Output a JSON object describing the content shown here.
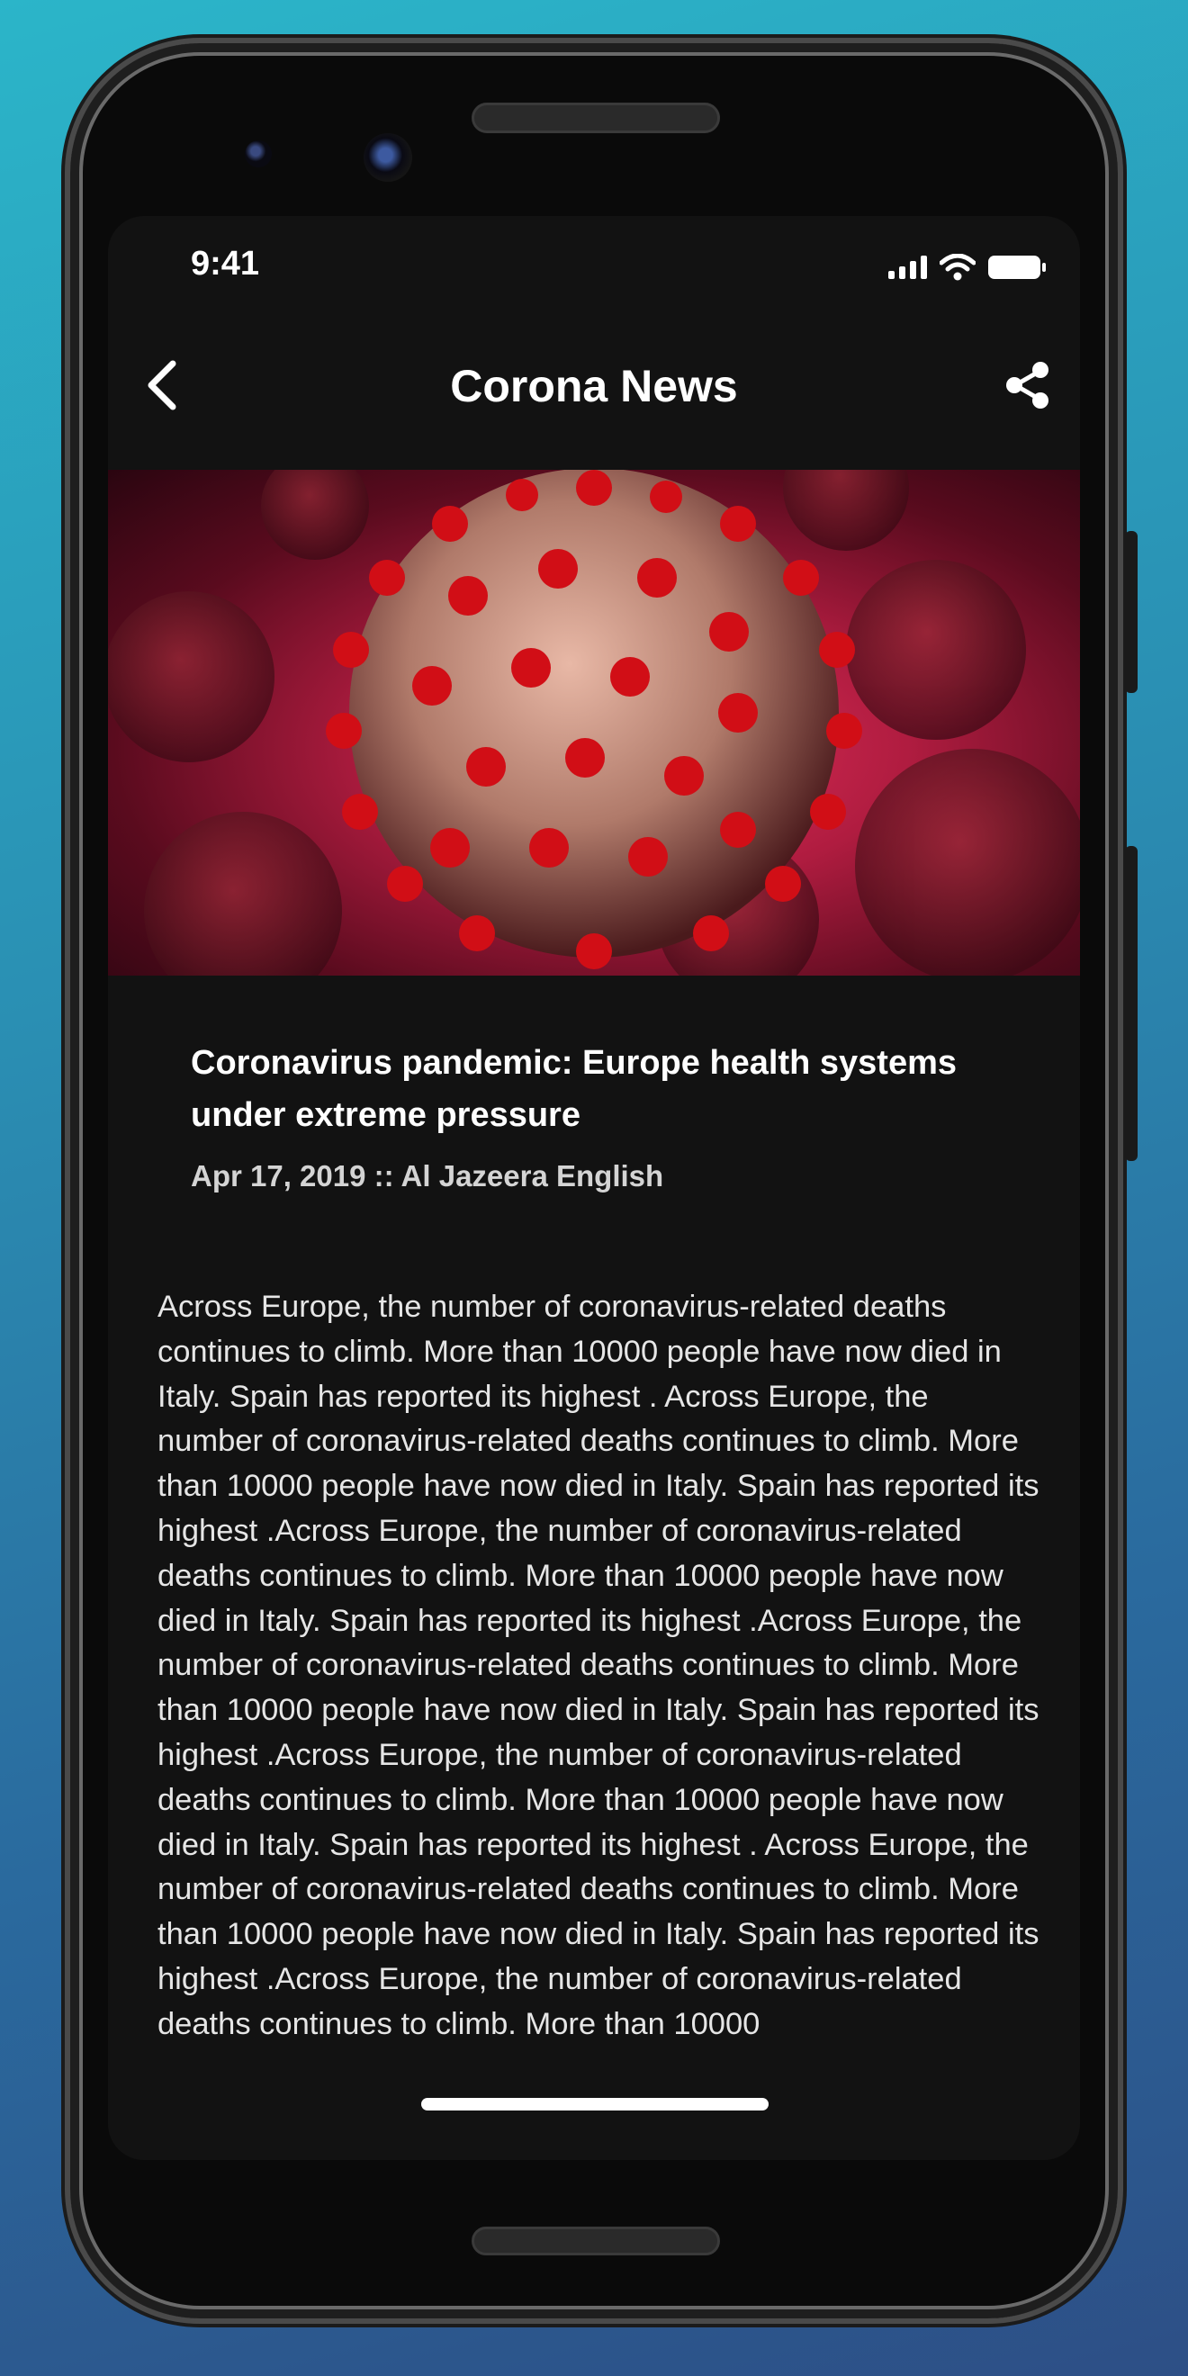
{
  "status_bar": {
    "time": "9:41"
  },
  "nav": {
    "title": "Corona News",
    "back_icon": "chevron-left-icon",
    "share_icon": "share-icon"
  },
  "hero": {
    "image": "coronavirus-illustration",
    "accent": "#c91d45"
  },
  "article": {
    "headline": "Coronavirus pandemic: Europe health systems under extreme pressure",
    "meta": "Apr 17, 2019 :: Al Jazeera English",
    "body": "Across Europe, the number of coronavirus-related deaths continues to climb. More than 10000 people have now died in Italy. Spain has reported its highest . Across Europe, the number of coronavirus-related deaths continues to climb. More than 10000 people have now died in Italy. Spain has reported its highest .Across Europe, the number of coronavirus-related deaths continues to climb. More than 10000 people have now died in Italy. Spain has reported its highest .Across Europe, the number of coronavirus-related deaths continues to climb. More than 10000 people have now died in Italy. Spain has reported its highest .Across Europe, the number of coronavirus-related deaths continues to climb. More than 10000 people have now died in Italy. Spain has reported its highest . Across Europe, the number of coronavirus-related deaths continues to climb. More than 10000 people have now died in Italy. Spain has reported its highest .Across Europe, the number of coronavirus-related deaths continues to climb. More than 10000"
  },
  "colors": {
    "screen_bg": "#121212",
    "text": "#ffffff",
    "meta_text": "#d4d4d4"
  }
}
